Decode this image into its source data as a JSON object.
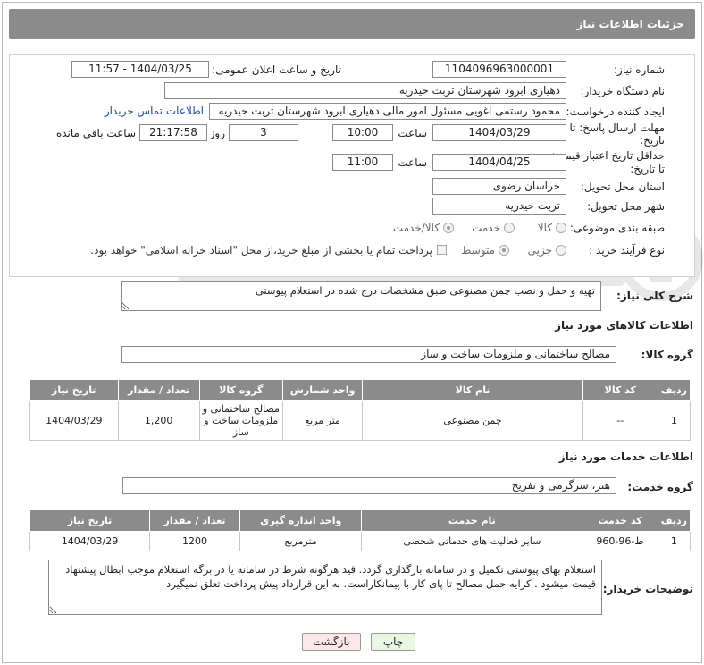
{
  "header": {
    "title": "جزئیات اطلاعات نیاز"
  },
  "form": {
    "need_number_label": "شماره نیاز:",
    "need_number": "1104096963000001",
    "announce_label": "تاریخ و ساعت اعلان عمومی:",
    "announce_value": "1404/03/25 - 11:57",
    "buyer_org_label": "نام دستگاه خریدار:",
    "buyer_org": "دهیاری ابرود  شهرستان تربت حیدریه",
    "creator_label": "ایجاد کننده درخواست:",
    "creator": "محمود رستمی آغویی مسئول امور مالی  دهیاری ابرود  شهرستان تربت حیدریه",
    "contact_link": "اطلاعات تماس خریدار",
    "deadline_label_1": "مهلت ارسال پاسخ: تا",
    "deadline_label_2": "تاریخ:",
    "deadline_date": "1404/03/29",
    "time_label": "ساعت",
    "deadline_time": "10:00",
    "days_value": "3",
    "days_label": "روز و",
    "remaining_time": "21:17:58",
    "remaining_label": "ساعت باقی مانده",
    "price_validity_label_1": "حداقل تاریخ اعتبار قیمت:",
    "price_validity_label_2": "تا تاریخ:",
    "validity_date": "1404/04/25",
    "validity_time": "11:00",
    "province_label": "استان محل تحویل:",
    "province": "خراسان رضوی",
    "city_label": "شهر محل تحویل:",
    "city": "تربت حیدریه",
    "category_label": "طبقه بندی موضوعی:",
    "category_options": [
      "کالا",
      "خدمت",
      "کالا/خدمت"
    ],
    "purchase_type_label": "نوع فرآیند خرید :",
    "purchase_options": [
      "جزیی",
      "متوسط"
    ],
    "payment_note": "پرداخت تمام یا بخشی از مبلغ خرید،از محل \"اسناد خزانه اسلامی\" خواهد بود."
  },
  "summary": {
    "label": "شرح کلی نیاز:",
    "text": "تهیه و حمل و نصب چمن مصنوعی طبق مشخصات درج شده در استعلام پیوستی"
  },
  "goods": {
    "section_title": "اطلاعات کالاهای مورد نیاز",
    "group_label": "گروه کالا:",
    "group_value": "مصالح ساختمانی و ملزومات ساخت و ساز",
    "columns": [
      "ردیف",
      "کد کالا",
      "نام کالا",
      "واحد شمارش",
      "گروه کالا",
      "تعداد / مقدار",
      "تاریخ نیاز"
    ],
    "rows": [
      [
        "1",
        "--",
        "چمن مصنوعی",
        "متر مربع",
        "مصالح ساختمانی و ملزومات ساخت و ساز",
        "1,200",
        "1404/03/29"
      ]
    ]
  },
  "services": {
    "section_title": "اطلاعات خدمات مورد نیاز",
    "group_label": "گروه خدمت:",
    "group_value": "هنر، سرگرمی و تفریح",
    "columns": [
      "ردیف",
      "کد خدمت",
      "نام خدمت",
      "واحد اندازه گیری",
      "تعداد / مقدار",
      "تاریخ نیاز"
    ],
    "rows": [
      [
        "1",
        "ط-96-960",
        "سایر فعالیت های خدماتی شخصی",
        "مترمربع",
        "1200",
        "1404/03/29"
      ]
    ]
  },
  "notes": {
    "label": "توضیحات خریدار:",
    "text": "استعلام بهای پیوستی تکمیل و در سامانه بارگذاری گردد. قید هرگونه شرط در سامانه یا در برگه استعلام موجب ابطال پیشنهاد قیمت میشود . کرایه حمل مصالح تا پای کار با پیمانکاراست. به این قرارداد پیش پرداخت تعلق نمیگیرد"
  },
  "buttons": {
    "print": "چاپ",
    "back": "بازگشت"
  },
  "colors": {
    "header_bg": "#8b8b8b",
    "link": "#1a4fa0",
    "back_btn": "#fde7ea",
    "print_btn": "#eaf7e4"
  }
}
